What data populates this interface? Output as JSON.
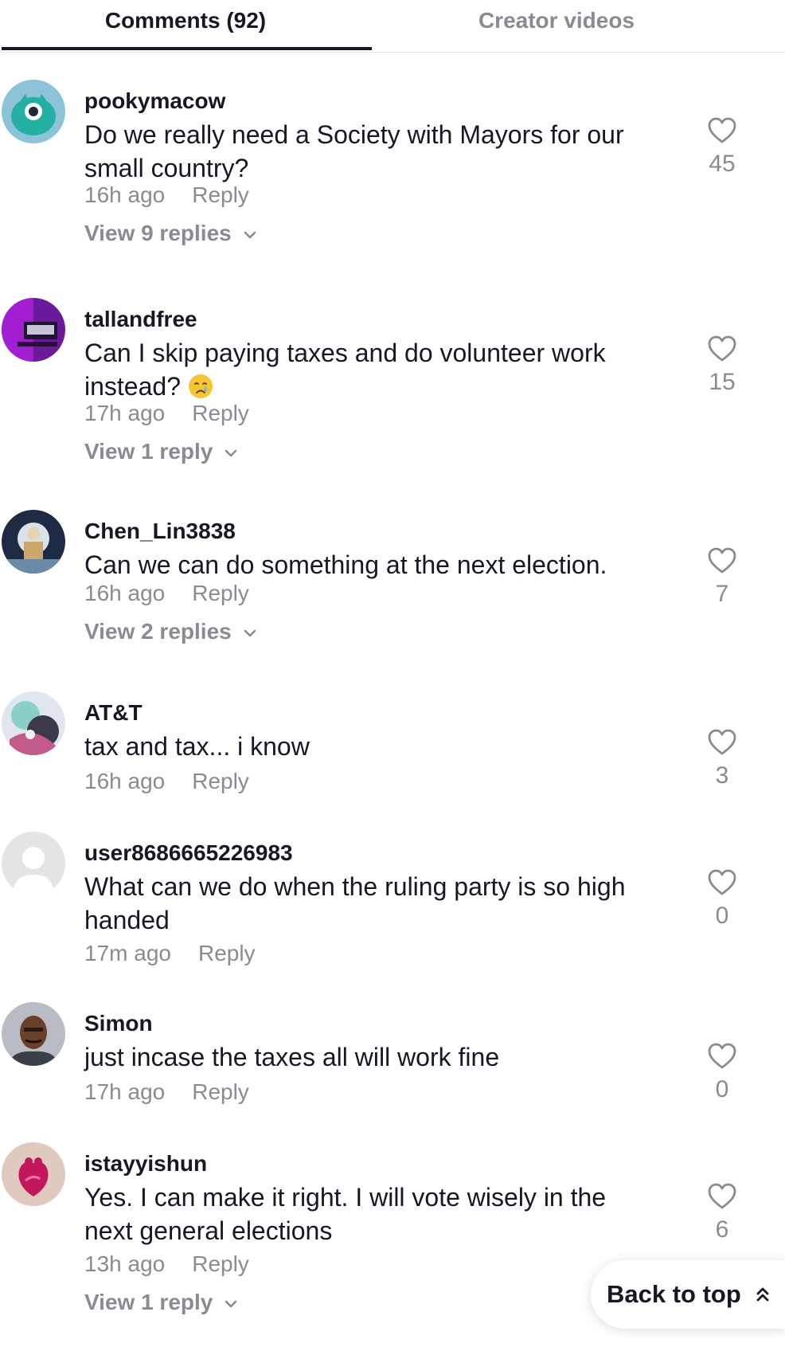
{
  "tabs": {
    "comments": "Comments (92)",
    "creator_videos": "Creator videos"
  },
  "comments": [
    {
      "username": "pookymacow",
      "text": "Do we really need a Society with Mayors for our small country?",
      "time": "16h ago",
      "reply": "Reply",
      "view_replies": "View 9 replies",
      "likes": "45"
    },
    {
      "username": "tallandfree",
      "text": "Can I skip paying taxes and do volunteer work instead?",
      "emoji": "crying-face",
      "time": "17h ago",
      "reply": "Reply",
      "view_replies": "View 1 reply",
      "likes": "15"
    },
    {
      "username": "Chen_Lin3838",
      "text": "Can we can do something at the next election.",
      "time": "16h ago",
      "reply": "Reply",
      "view_replies": "View 2 replies",
      "likes": "7"
    },
    {
      "username": "AT&T",
      "text": "tax and tax... i know",
      "time": "16h ago",
      "reply": "Reply",
      "likes": "3"
    },
    {
      "username": "user8686665226983",
      "text": "What can we do when the ruling party is so high handed",
      "time": "17m ago",
      "reply": "Reply",
      "likes": "0"
    },
    {
      "username": "Simon",
      "text": "just incase the taxes all will work fine",
      "time": "17h ago",
      "reply": "Reply",
      "likes": "0"
    },
    {
      "username": "istayyishun",
      "text": "Yes. I can make it right. I will vote wisely in the next general elections",
      "time": "13h ago",
      "reply": "Reply",
      "view_replies": "View 1 reply",
      "likes": "6"
    }
  ],
  "back_to_top": "Back to top",
  "colors": {
    "primary_text": "#161823",
    "secondary_text": "#8a8b91",
    "divider": "#e3e3e4"
  }
}
